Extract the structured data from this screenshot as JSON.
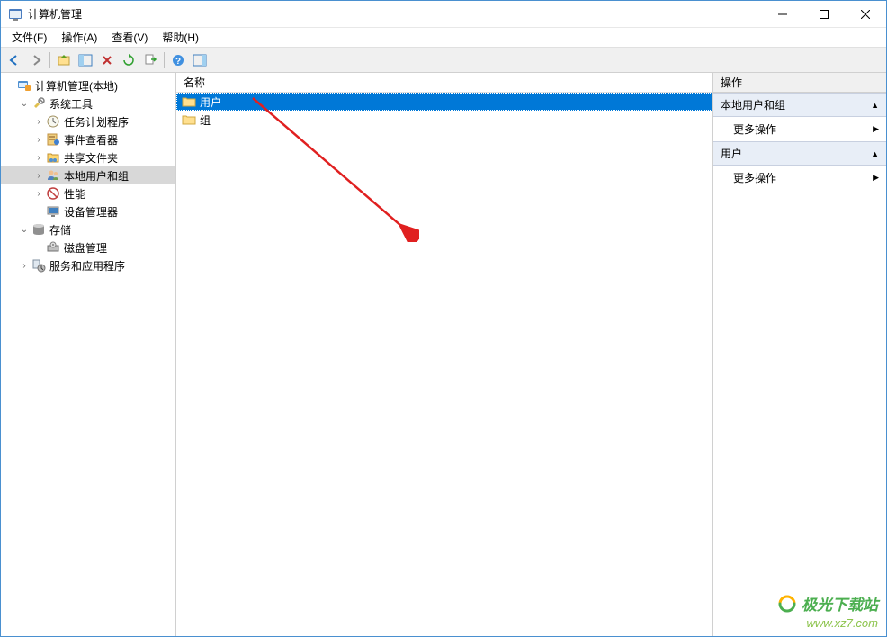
{
  "window": {
    "title": "计算机管理"
  },
  "menubar": {
    "file": "文件(F)",
    "action": "操作(A)",
    "view": "查看(V)",
    "help": "帮助(H)"
  },
  "tree": {
    "root": "计算机管理(本地)",
    "system_tools": "系统工具",
    "task_scheduler": "任务计划程序",
    "event_viewer": "事件查看器",
    "shared_folders": "共享文件夹",
    "local_users_groups": "本地用户和组",
    "performance": "性能",
    "device_manager": "设备管理器",
    "storage": "存储",
    "disk_management": "磁盘管理",
    "services_apps": "服务和应用程序"
  },
  "list": {
    "header": "名称",
    "items": [
      {
        "label": "用户",
        "selected": true
      },
      {
        "label": "组",
        "selected": false
      }
    ]
  },
  "actions": {
    "header": "操作",
    "section1": "本地用户和组",
    "more_actions": "更多操作",
    "section2": "用户"
  },
  "watermark": {
    "text": "极光下载站",
    "url": "www.xz7.com"
  }
}
